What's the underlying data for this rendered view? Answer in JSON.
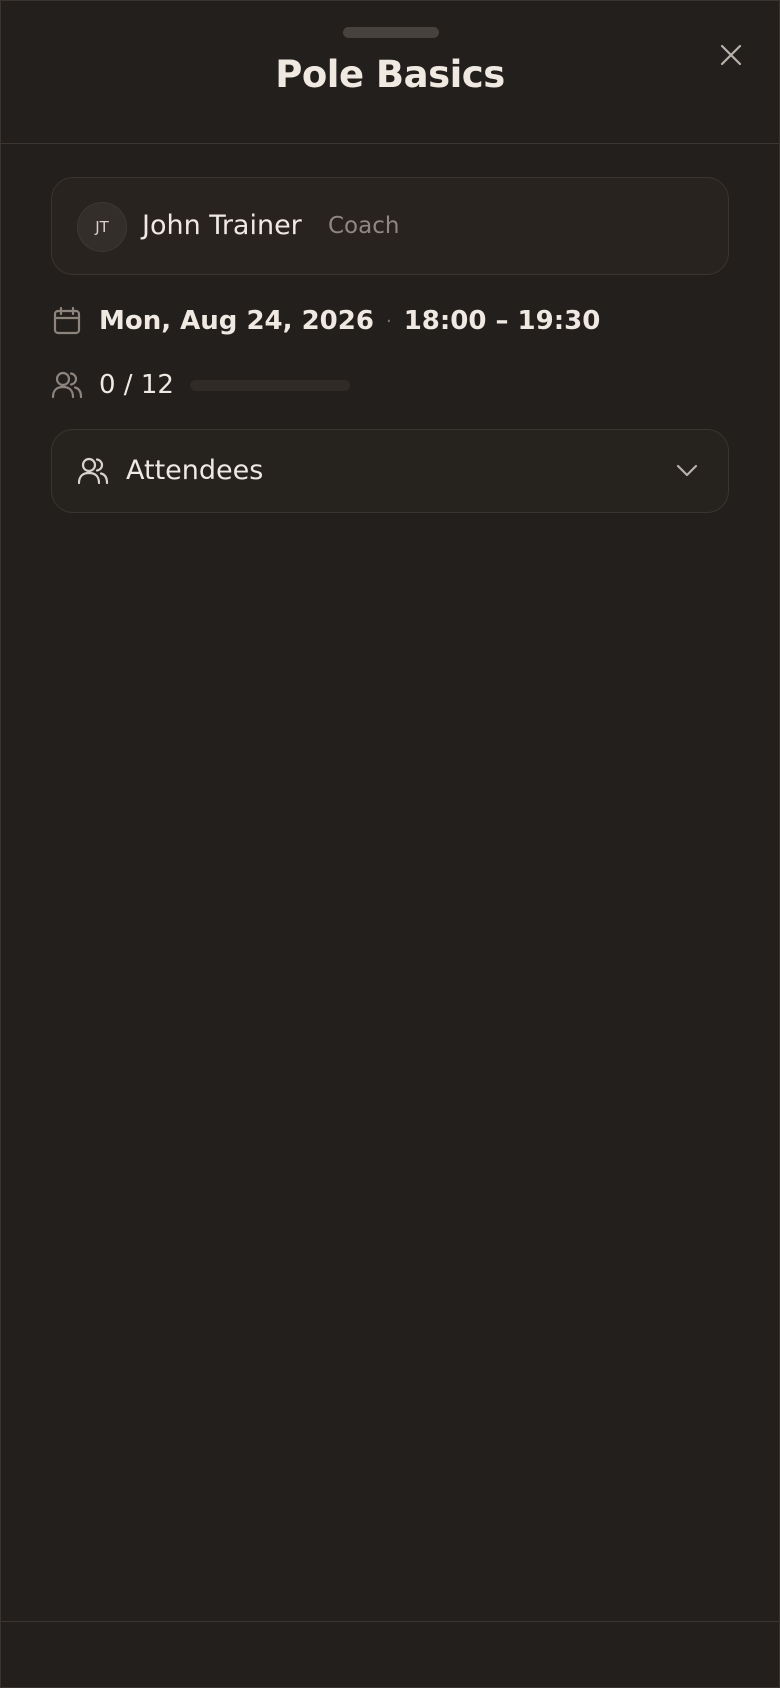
{
  "header": {
    "title": "Pole Basics",
    "close_icon": "close-icon"
  },
  "coach": {
    "initials": "JT",
    "name": "John Trainer",
    "role": "Coach"
  },
  "schedule": {
    "icon": "calendar-icon",
    "date": "Mon, Aug 24, 2026",
    "separator": "·",
    "time": "18:00 – 19:30"
  },
  "capacity": {
    "icon": "users-icon",
    "text": "0 / 12",
    "booked": 0,
    "max": 12,
    "fill_fraction": 0
  },
  "attendees": {
    "icon": "users-icon",
    "label": "Attendees",
    "toggle_icon": "chevron-down-icon"
  },
  "colors": {
    "background": "#231f1c",
    "text": "#efe9e2",
    "muted": "#8f8780",
    "border": "#3a3531"
  }
}
